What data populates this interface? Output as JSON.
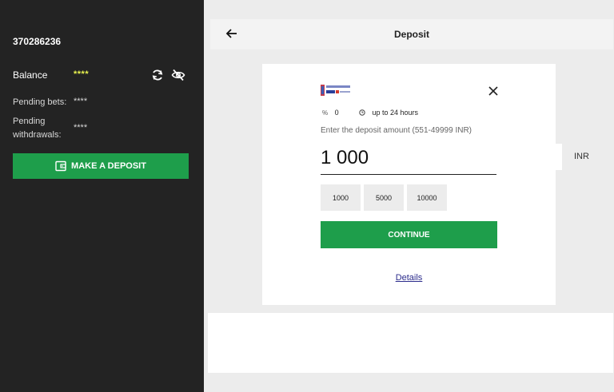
{
  "sidebar": {
    "account_id": "370286236",
    "balance_label": "Balance",
    "balance_value": "****",
    "pending_bets_label": "Pending bets:",
    "pending_bets_value": "****",
    "pending_withdrawals_label_line1": "Pending",
    "pending_withdrawals_label_line2": "withdrawals:",
    "pending_withdrawals_value": "****",
    "deposit_button": "MAKE A DEPOSIT",
    "icons": [
      "refresh-icon",
      "eye-off-icon",
      "wallet-icon"
    ]
  },
  "header": {
    "title": "Deposit",
    "back_icon": "arrow-left-icon"
  },
  "deposit_form": {
    "fee_value": "0",
    "time_value": "up to 24 hours",
    "prompt": "Enter the deposit amount (551-49999 INR)",
    "amount": "1 000",
    "currency": "INR",
    "presets": [
      "1000",
      "5000",
      "10000"
    ],
    "continue_label": "CONTINUE",
    "details_label": "Details"
  },
  "colors": {
    "sidebar_bg": "#232323",
    "accent_green": "#1e9e4b",
    "balance_yellow": "#e8f24f",
    "link": "#2c2c8c"
  }
}
